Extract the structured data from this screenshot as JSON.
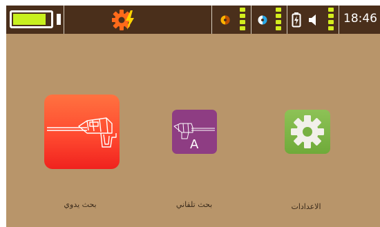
{
  "status_bar": {
    "battery_level_fraction": 0.88,
    "clock": "18:46",
    "indicators": [
      {
        "name": "sensor-a-icon",
        "color": "#ffb300"
      },
      {
        "name": "sensor-b-icon",
        "color": "#2aa8e6"
      },
      {
        "name": "battery-charge-icon",
        "color": "#ffffff"
      },
      {
        "name": "speaker-icon",
        "color": "#ffffff"
      }
    ],
    "level_color": "#d4ee1e"
  },
  "menu": {
    "items": [
      {
        "label": "بحث يدوي",
        "icon": "manual-detector-icon",
        "color": "#ff4a30"
      },
      {
        "label": "بحث تلقاني",
        "icon": "auto-detector-icon",
        "badge": "A",
        "color": "#8e3d83"
      },
      {
        "label": "الاعدادات",
        "icon": "gear-icon",
        "color": "#7ab544"
      }
    ]
  },
  "colors": {
    "status_bar_bg": "#4a2f1b",
    "screen_bg": "#b8956a",
    "settings_alert_gear": "#ff6a1a",
    "alert_bolt": "#ffd400"
  }
}
